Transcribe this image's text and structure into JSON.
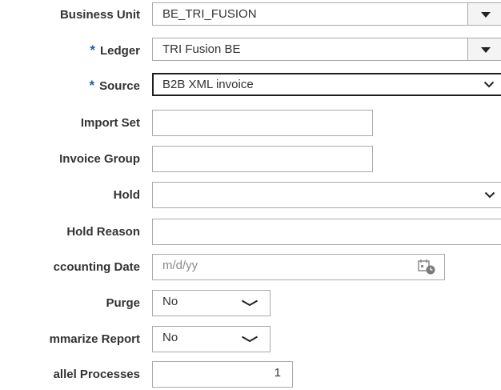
{
  "form": {
    "business_unit": {
      "label": "Business Unit",
      "value": "BE_TRI_FUSION",
      "button_icon": "triangle-down-icon"
    },
    "ledger": {
      "required_marker": "*",
      "label": "Ledger",
      "value": "TRI Fusion BE",
      "button_icon": "triangle-down-icon"
    },
    "source": {
      "required_marker": "*",
      "label": "Source",
      "value": "B2B XML invoice",
      "icon": "chevron-down-icon"
    },
    "import_set": {
      "label": "Import Set",
      "value": ""
    },
    "invoice_group": {
      "label": "Invoice Group",
      "value": ""
    },
    "hold": {
      "label": "Hold",
      "value": "",
      "icon": "chevron-down-icon"
    },
    "hold_reason": {
      "label": "Hold Reason",
      "value": ""
    },
    "accounting_date": {
      "label": "ccounting Date",
      "placeholder": "m/d/yy",
      "icon": "calendar-icon"
    },
    "purge": {
      "label": "Purge",
      "value": "No",
      "icon": "chevron-down-icon"
    },
    "summarize_report": {
      "label": "mmarize Report",
      "value": "No",
      "icon": "chevron-down-icon"
    },
    "parallel_processes": {
      "label": "allel Processes",
      "value": "1"
    }
  },
  "colors": {
    "required": "#1a5fb4",
    "border": "#a8a8a8",
    "focus_border": "#1f1f1f",
    "label_text": "#333333"
  }
}
